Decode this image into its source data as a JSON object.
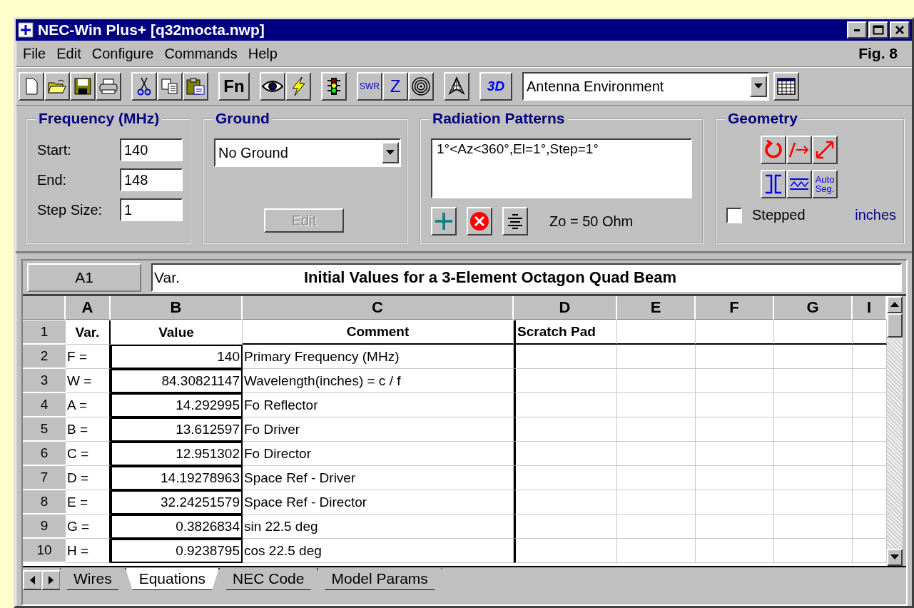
{
  "window": {
    "title": "NEC-Win Plus+ [q32mocta.nwp]"
  },
  "menu": [
    {
      "label": "File"
    },
    {
      "label": "Edit"
    },
    {
      "label": "Configure"
    },
    {
      "label": "Commands"
    },
    {
      "label": "Help"
    }
  ],
  "figure_label": "Fig. 8",
  "toolbar": {
    "fn": "Fn",
    "swr": "SWR",
    "z": "Z",
    "three_d": "3D",
    "view_select": "Antenna Environment"
  },
  "frequency": {
    "title": "Frequency (MHz)",
    "fields": [
      {
        "label": "Start:",
        "value": "140"
      },
      {
        "label": "End:",
        "value": "148"
      },
      {
        "label": "Step Size:",
        "value": "1"
      }
    ]
  },
  "ground": {
    "title": "Ground",
    "select": "No Ground",
    "edit_button": {
      "label": "Edit",
      "disabled": true
    }
  },
  "radiation": {
    "title": "Radiation Patterns",
    "patterns": "1°<Az<360°,El=1°,Step=1°",
    "impedance": "Zo = 50 Ohm"
  },
  "geometry": {
    "title": "Geometry",
    "auto_seg": "Auto Seg.",
    "stepped": {
      "label": "Stepped",
      "checked": false
    },
    "units": "inches"
  },
  "sheet": {
    "cell_ref": "A1",
    "cell_content": "Var.",
    "sheet_title": "Initial Values for a 3-Element Octagon Quad Beam",
    "columns": [
      "A",
      "B",
      "C",
      "D",
      "E",
      "F",
      "G",
      "I"
    ],
    "rows": [
      {
        "number": "1",
        "cells": [
          "Var.",
          "Value",
          "Comment",
          "Scratch Pad"
        ]
      },
      {
        "number": "2",
        "cells": [
          "F =",
          "140",
          "Primary Frequency (MHz)"
        ]
      },
      {
        "number": "3",
        "cells": [
          "W =",
          "84.30821147",
          "Wavelength(inches) = c / f"
        ]
      },
      {
        "number": "4",
        "cells": [
          "A =",
          "14.292995",
          "Fo Reflector"
        ]
      },
      {
        "number": "5",
        "cells": [
          "B =",
          "13.612597",
          "Fo Driver"
        ]
      },
      {
        "number": "6",
        "cells": [
          "C =",
          "12.951302",
          "Fo Director"
        ]
      },
      {
        "number": "7",
        "cells": [
          "D =",
          "14.19278963",
          "Space Ref - Driver"
        ]
      },
      {
        "number": "8",
        "cells": [
          "E =",
          "32.24251579",
          "Space Ref - Director"
        ]
      },
      {
        "number": "9",
        "cells": [
          "G =",
          "0.3826834",
          "sin 22.5 deg"
        ]
      },
      {
        "number": "10",
        "cells": [
          "H =",
          "0.9238795",
          "cos 22.5 deg"
        ]
      }
    ],
    "tabs": [
      {
        "label": "Wires",
        "selected": false
      },
      {
        "label": "Equations",
        "selected": true
      },
      {
        "label": "NEC Code",
        "selected": false
      },
      {
        "label": "Model Params",
        "selected": false
      }
    ]
  }
}
